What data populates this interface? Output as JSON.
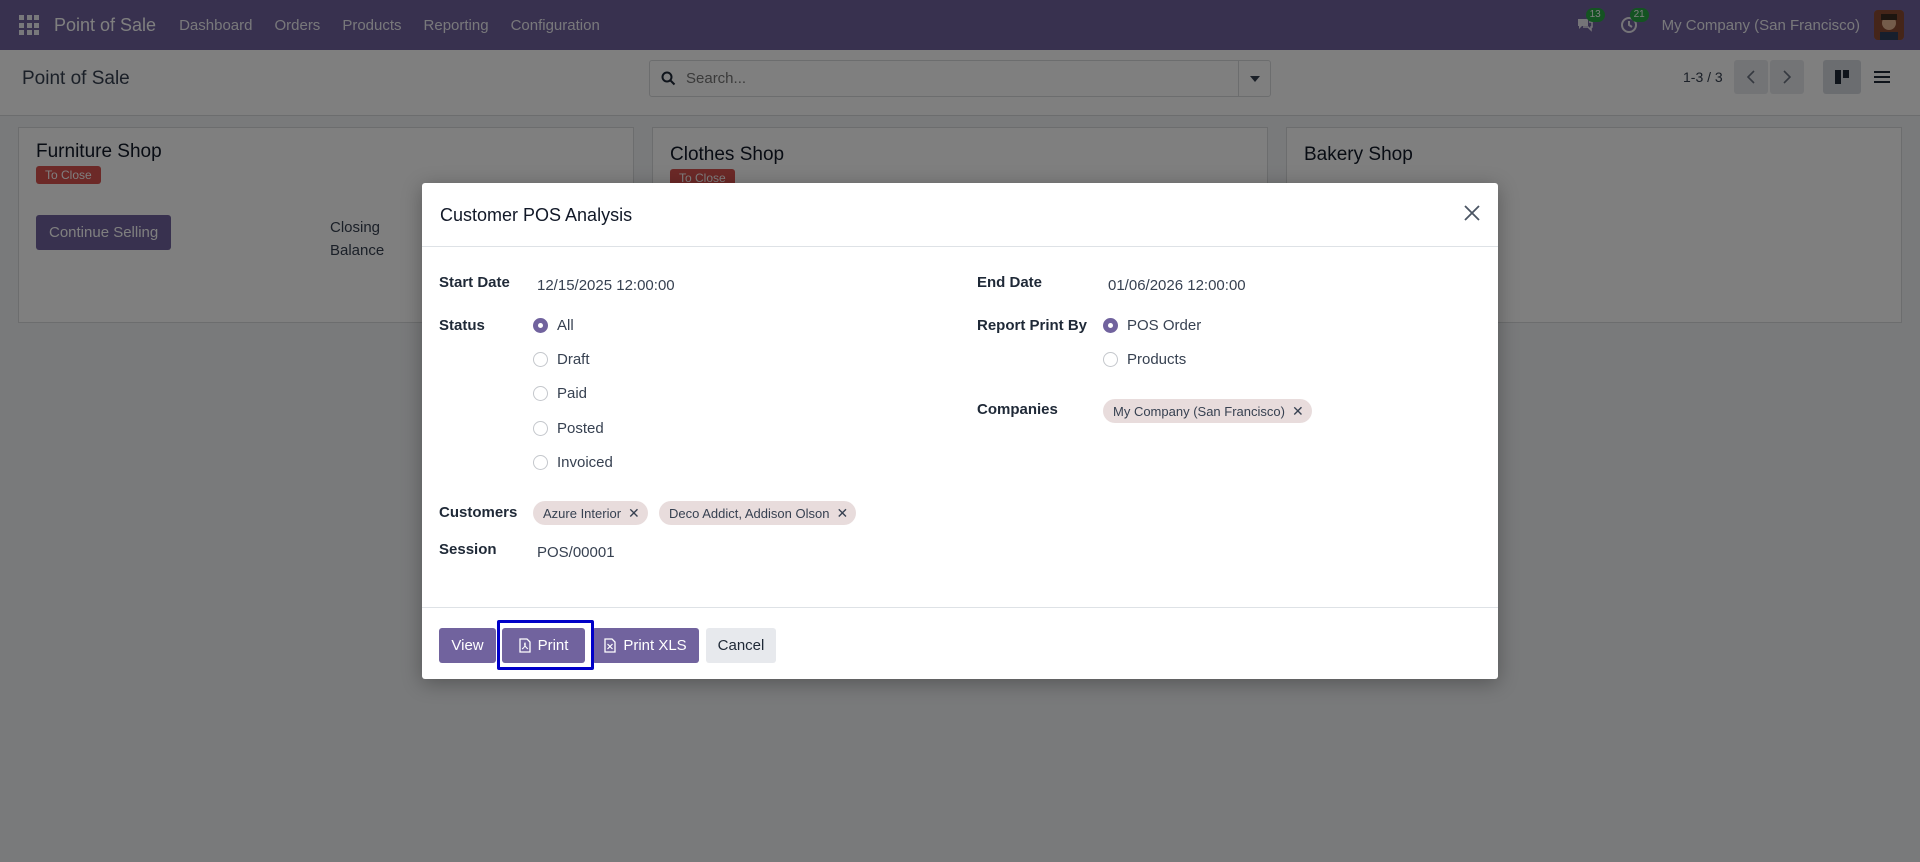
{
  "navbar": {
    "app_name": "Point of Sale",
    "menu": [
      "Dashboard",
      "Orders",
      "Products",
      "Reporting",
      "Configuration"
    ],
    "messages_count": "13",
    "activities_count": "21",
    "company": "My Company (San Francisco)"
  },
  "control_panel": {
    "title": "Point of Sale",
    "search_placeholder": "Search...",
    "pager": "1-3 / 3"
  },
  "cards": [
    {
      "title": "Furniture Shop",
      "status": "To Close",
      "action": "Continue Selling",
      "closing_label_1": "Closing",
      "closing_label_2": "Balance"
    },
    {
      "title": "Clothes Shop",
      "status": "To Close"
    },
    {
      "title": "Bakery Shop"
    }
  ],
  "dialog": {
    "title": "Customer POS Analysis",
    "start_date_label": "Start Date",
    "start_date": "12/15/2025 12:00:00",
    "end_date_label": "End Date",
    "end_date": "01/06/2026 12:00:00",
    "status_label": "Status",
    "status_options": [
      "All",
      "Draft",
      "Paid",
      "Posted",
      "Invoiced"
    ],
    "status_selected": "All",
    "report_print_by_label": "Report Print By",
    "report_print_by_options": [
      "POS Order",
      "Products"
    ],
    "report_print_by_selected": "POS Order",
    "companies_label": "Companies",
    "companies": [
      "My Company (San Francisco)"
    ],
    "customers_label": "Customers",
    "customers": [
      "Azure Interior",
      "Deco Addict, Addison Olson"
    ],
    "session_label": "Session",
    "session": "POS/00001",
    "buttons": {
      "view": "View",
      "print": "Print",
      "print_xls": "Print XLS",
      "cancel": "Cancel"
    }
  },
  "colors": {
    "brand": "#71639e",
    "danger": "#d9534f",
    "badge": "#28a745",
    "focus": "#0000c8"
  }
}
